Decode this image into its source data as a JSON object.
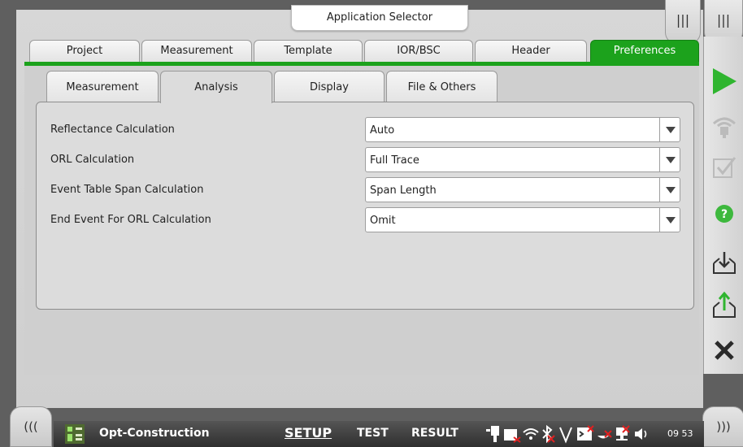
{
  "header": {
    "app_selector": "Application Selector"
  },
  "top_tabs": [
    {
      "label": "Project"
    },
    {
      "label": "Measurement"
    },
    {
      "label": "Template"
    },
    {
      "label": "IOR/BSC"
    },
    {
      "label": "Header"
    },
    {
      "label": "Preferences",
      "active": true
    }
  ],
  "sub_tabs": [
    {
      "label": "Measurement"
    },
    {
      "label": "Analysis",
      "active": true
    },
    {
      "label": "Display"
    },
    {
      "label": "File & Others"
    }
  ],
  "settings": [
    {
      "label": "Reflectance Calculation",
      "value": "Auto"
    },
    {
      "label": "ORL Calculation",
      "value": "Full Trace"
    },
    {
      "label": "Event Table Span Calculation",
      "value": "Span Length"
    },
    {
      "label": "End Event For ORL Calculation",
      "value": "Omit"
    }
  ],
  "sidebar": {
    "buttons": [
      "start-icon",
      "laser-icon",
      "checklist-icon",
      "help-icon",
      "save-icon",
      "open-icon",
      "close-icon"
    ],
    "corner_left_label": "|||",
    "corner_right_label": "|||"
  },
  "bottom_bar": {
    "app_name": "Opt-Construction",
    "nav": [
      "SETUP",
      "TEST",
      "RESULT"
    ],
    "current_nav": "SETUP",
    "clock": "09 53",
    "left_button": "(((",
    "right_button": ")))"
  },
  "colors": {
    "accent_green": "#1ca21c",
    "status_red": "#e02020"
  }
}
